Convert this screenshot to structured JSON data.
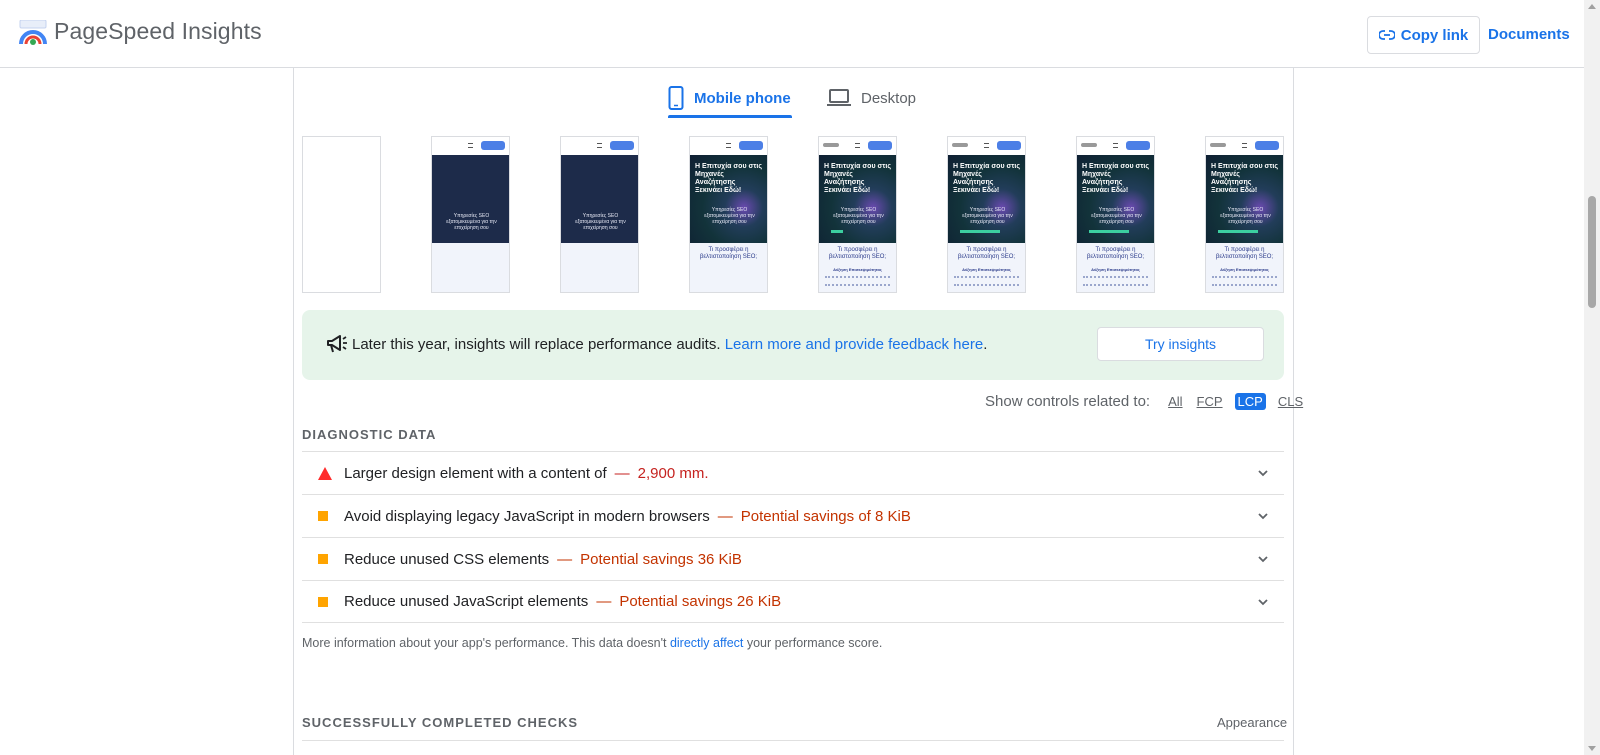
{
  "header": {
    "app_title": "PageSpeed Insights",
    "copy_link_label": "Copy link",
    "documents_label": "Documents",
    "logo_icon": "pagespeed-gauge-icon"
  },
  "tabs": [
    {
      "label": "Mobile phone",
      "icon": "smartphone-icon",
      "selected": true
    },
    {
      "label": "Desktop",
      "icon": "laptop-icon",
      "selected": false
    }
  ],
  "filmstrip": {
    "frames": [
      {
        "kind": "blank"
      },
      {
        "kind": "plain",
        "hero_sub": "Υπηρεσίες SEO εξατομικευμένα για την επιχείρηση σου"
      },
      {
        "kind": "plain",
        "hero_sub": "Υπηρεσίες SEO εξατομικευμένα για την επιχείρηση σου"
      },
      {
        "kind": "full",
        "hero_title": "Η Επιτυχία σου στις Μηχανές Αναζήτησης Ξεκινάει Εδώ!",
        "hero_sub": "Υπηρεσίες SEO εξατομικευμένα για την επιχείρηση σου",
        "question": "Τι προσφέρει η βελτιστοποίηση SEO;"
      },
      {
        "kind": "full",
        "hero_title": "Η Επιτυχία σου στις Μηχανές Αναζήτησης Ξεκινάει Εδώ!",
        "hero_sub": "Υπηρεσίες SEO εξατομικευμένα για την επιχείρηση σου",
        "question": "Τι προσφέρει η βελτιστοποίηση SEO;",
        "heading": "Αύξηση Επισκεψιμότητας"
      },
      {
        "kind": "full",
        "hero_title": "Η Επιτυχία σου στις Μηχανές Αναζήτησης Ξεκινάει Εδώ!",
        "hero_sub": "Υπηρεσίες SEO εξατομικευμένα για την επιχείρηση σου",
        "question": "Τι προσφέρει η βελτιστοποίηση SEO;",
        "heading": "Αύξηση Επισκεψιμότητας"
      },
      {
        "kind": "full",
        "hero_title": "Η Επιτυχία σου στις Μηχανές Αναζήτησης Ξεκινάει Εδώ!",
        "hero_sub": "Υπηρεσίες SEO εξατομικευμένα για την επιχείρηση σου",
        "question": "Τι προσφέρει η βελτιστοποίηση SEO;",
        "heading": "Αύξηση Επισκεψιμότητας"
      },
      {
        "kind": "full",
        "hero_title": "Η Επιτυχία σου στις Μηχανές Αναζήτησης Ξεκινάει Εδώ!",
        "hero_sub": "Υπηρεσίες SEO εξατομικευμένα για την επιχείρηση σου",
        "question": "Τι προσφέρει η βελτιστοποίηση SEO;",
        "heading": "Αύξηση Επισκεψιμότητας"
      }
    ]
  },
  "banner": {
    "icon": "megaphone-icon",
    "text": "Later this year, insights will replace performance audits.",
    "link_text": "Learn more and provide feedback here",
    "period": ".",
    "button_label": "Try insights"
  },
  "controls": {
    "label": "Show controls related to:",
    "options": [
      {
        "label": "All",
        "active": false
      },
      {
        "label": "FCP",
        "active": false
      },
      {
        "label": "LCP",
        "active": true
      },
      {
        "label": "CLS",
        "active": false
      }
    ]
  },
  "diagnostics": {
    "title": "DIAGNOSTIC DATA",
    "items": [
      {
        "severity": "fail",
        "title": "Larger design element with a content of",
        "value": "2,900 mm."
      },
      {
        "severity": "average",
        "title": "Avoid displaying legacy JavaScript in modern browsers",
        "value": "Potential savings of 8 KiB"
      },
      {
        "severity": "average",
        "title": "Reduce unused CSS elements",
        "value": "Potential savings 36 KiB"
      },
      {
        "severity": "average",
        "title": "Reduce unused JavaScript elements",
        "value": "Potential savings 26 KiB"
      }
    ],
    "dash": "—",
    "info_before": "More information about your app's performance. This data doesn't",
    "info_link": "directly affect",
    "info_after": "your performance score."
  },
  "passed": {
    "title": "SUCCESSFULLY COMPLETED CHECKS",
    "appearance_label": "Appearance"
  },
  "colors": {
    "accent": "#1a73e8",
    "fail": "#ff2b2b",
    "average": "#ffa400",
    "banner_bg": "#e6f4ea"
  }
}
